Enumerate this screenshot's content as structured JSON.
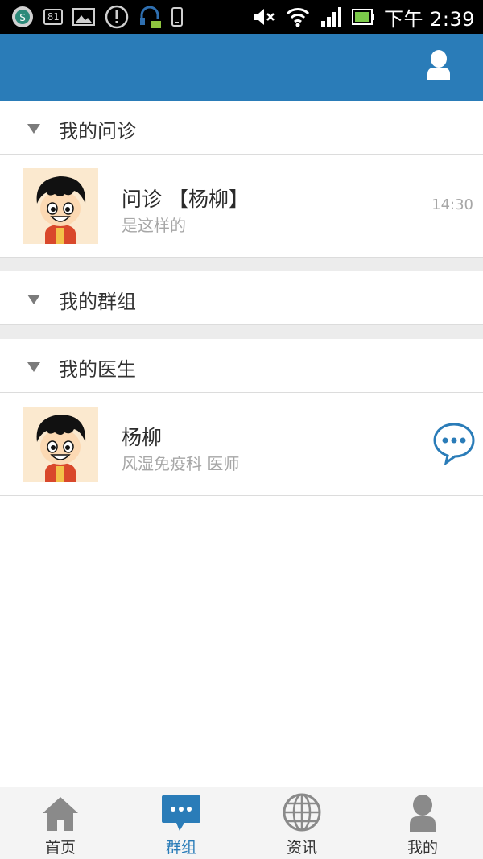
{
  "status_bar": {
    "notification_count": "81",
    "time": "下午 2:39",
    "icons": [
      "shield-icon",
      "notification-badge",
      "image-icon",
      "alert-icon",
      "headset-icon",
      "phone-icon",
      "mute-icon",
      "wifi-icon",
      "signal-icon",
      "battery-icon"
    ]
  },
  "header": {
    "profile_icon": "user-icon",
    "accent": "#2a7cb8"
  },
  "sections": {
    "consult": {
      "title": "我的问诊",
      "items": [
        {
          "title": "问诊 【杨柳】",
          "subtitle": "是这样的",
          "time": "14:30"
        }
      ]
    },
    "groups": {
      "title": "我的群组"
    },
    "doctors": {
      "title": "我的医生",
      "items": [
        {
          "name": "杨柳",
          "subtitle": "风湿免疫科 医师"
        }
      ]
    }
  },
  "bottom_nav": {
    "items": [
      {
        "label": "首页",
        "icon": "home-icon"
      },
      {
        "label": "群组",
        "icon": "chat-icon",
        "active": true
      },
      {
        "label": "资讯",
        "icon": "globe-icon"
      },
      {
        "label": "我的",
        "icon": "user-icon"
      }
    ]
  }
}
